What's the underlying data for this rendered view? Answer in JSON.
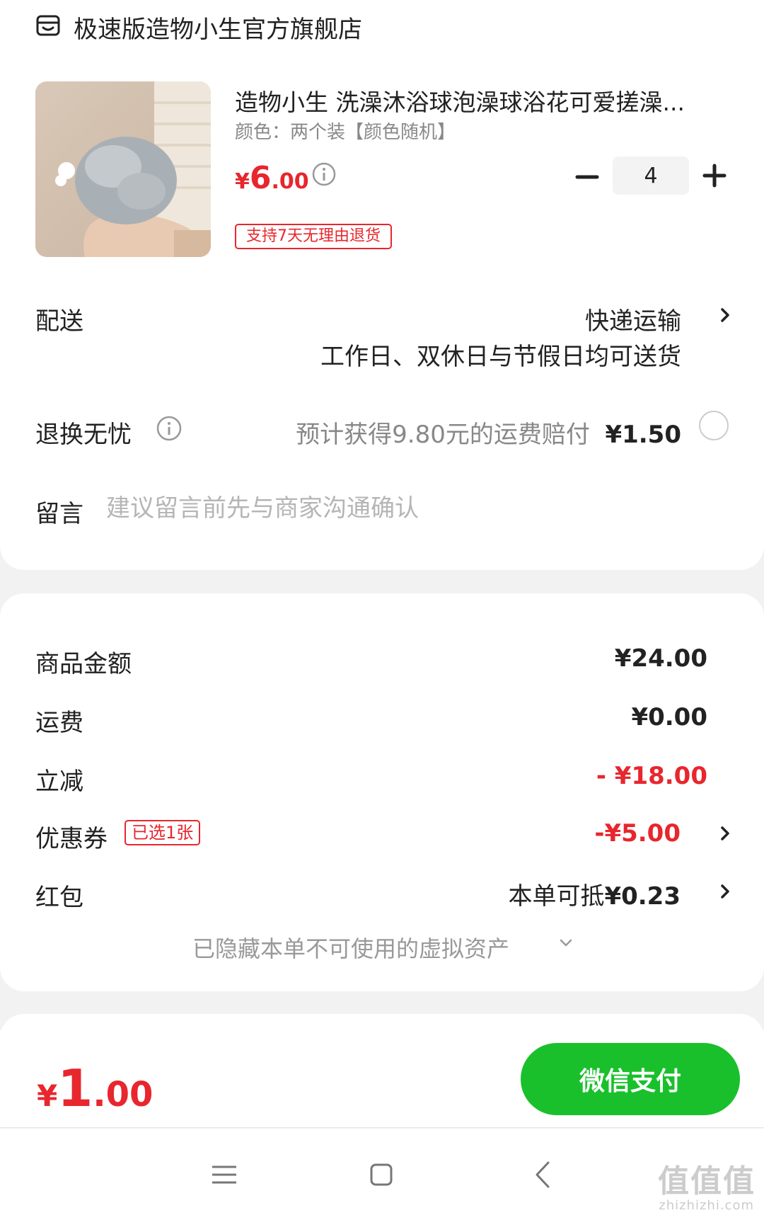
{
  "shop": {
    "name": "极速版造物小生官方旗舰店",
    "icon": "shop-icon"
  },
  "product": {
    "title": "造物小生 洗澡沐浴球泡澡球浴花可爱搓澡...",
    "spec": "颜色：两个装【颜色随机】",
    "price_yen": "¥",
    "price_int": "6",
    "price_dec": ".00",
    "quantity": "4",
    "return_badge": "支持7天无理由退货",
    "image_icon": "bath-sponge-photo"
  },
  "delivery": {
    "label": "配送",
    "method": "快递运输",
    "note": "工作日、双休日与节假日均可送货"
  },
  "exchange": {
    "label": "退换无忧",
    "desc": "预计获得9.80元的运费赔付",
    "price": "¥1.50"
  },
  "message": {
    "label": "留言",
    "placeholder": "建议留言前先与商家沟通确认"
  },
  "summary": {
    "goods_label": "商品金额",
    "goods_value": "¥24.00",
    "shipping_label": "运费",
    "shipping_value": "¥0.00",
    "discount_label": "立减",
    "discount_value": "- ¥18.00",
    "coupon_label": "优惠券",
    "coupon_badge": "已选1张",
    "coupon_value": "-¥5.00",
    "hongbao_label": "红包",
    "hongbao_prefix": "本单可抵",
    "hongbao_amount": "¥0.23",
    "hidden_assets": "已隐藏本单不可使用的虚拟资产"
  },
  "pay": {
    "total_yen": "¥",
    "total_int": "1",
    "total_dec": ".00",
    "button_label": "微信支付",
    "button_color": "#19c02b"
  },
  "accent_red": "#e8262d",
  "watermark": {
    "main": "值值值",
    "sub": "zhizhizhi.com"
  }
}
